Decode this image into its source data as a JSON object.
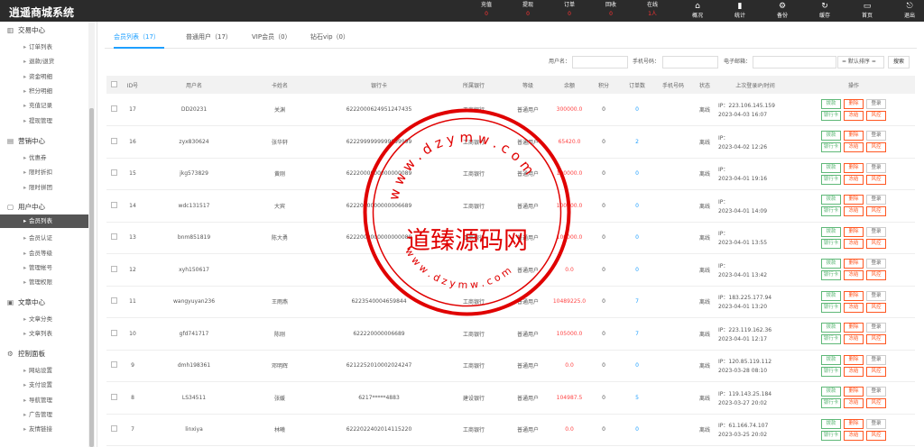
{
  "app": {
    "title": "逍遥商城系统"
  },
  "topstats": [
    {
      "label": "充值",
      "value": "0"
    },
    {
      "label": "提现",
      "value": "0"
    },
    {
      "label": "订单",
      "value": "0"
    },
    {
      "label": "回收",
      "value": "0"
    },
    {
      "label": "在线",
      "value": "1人"
    }
  ],
  "topnav": [
    {
      "label": "概况",
      "icon": "home-icon"
    },
    {
      "label": "统计",
      "icon": "bar-chart-icon"
    },
    {
      "label": "备份",
      "icon": "gear-icon"
    },
    {
      "label": "缓存",
      "icon": "refresh-icon"
    },
    {
      "label": "首页",
      "icon": "monitor-icon"
    },
    {
      "label": "退出",
      "icon": "logout-icon"
    }
  ],
  "sidebar": {
    "groups": [
      {
        "label": "交易中心",
        "icon": "chart-icon",
        "items": [
          "订单列表",
          "退款/退货",
          "资金明细",
          "积分明细",
          "充值记录",
          "提现管理"
        ]
      },
      {
        "label": "营销中心",
        "icon": "marketing-icon",
        "items": [
          "优惠券",
          "限时折扣",
          "限时拼团"
        ]
      },
      {
        "label": "用户中心",
        "icon": "user-icon",
        "items": [
          "会员列表",
          "会员认证",
          "会员等级",
          "管理帐号",
          "管理权限"
        ]
      },
      {
        "label": "文章中心",
        "icon": "article-icon",
        "items": [
          "文章分类",
          "文章列表"
        ]
      },
      {
        "label": "控制面板",
        "icon": "settings-icon",
        "items": [
          "网站设置",
          "支付设置",
          "导航管理",
          "广告管理",
          "友情链接"
        ]
      }
    ],
    "active": "会员列表"
  },
  "tabs": [
    {
      "label": "会员列表（17）"
    },
    {
      "label": "普通用户（17）"
    },
    {
      "label": "VIP会员（0）"
    },
    {
      "label": "钻石vip（0）"
    }
  ],
  "search": {
    "username_label": "用户名：",
    "phone_label": "手机号码：",
    "email_label": "电子邮箱：",
    "sort_value": "= 默认排序 =",
    "search_button": "搜索"
  },
  "table": {
    "headers": [
      "ID号",
      "用户名",
      "卡姓名",
      "银行卡",
      "所属银行",
      "等级",
      "余额",
      "积分",
      "订单数",
      "手机号码",
      "状态",
      "上次登录IP/时间",
      "操作"
    ],
    "rows": [
      {
        "id": "17",
        "username": "DD20231",
        "name": "关渊",
        "card": "6222000624951247435",
        "bank": "工商银行",
        "level": "普通用户",
        "balance": "300000.0",
        "points": "0",
        "orders": "0",
        "phone": "",
        "status": "离线",
        "ip": "IP：223.106.145.159",
        "time": "2023-04-03 16:07"
      },
      {
        "id": "16",
        "username": "zyx830624",
        "name": "张华轩",
        "card": "6222999999999999999",
        "bank": "工商银行",
        "level": "普通用户",
        "balance": "65420.0",
        "points": "0",
        "orders": "2",
        "phone": "",
        "status": "离线",
        "ip": "IP：",
        "time": "2023-04-02 12:26"
      },
      {
        "id": "15",
        "username": "jkg573829",
        "name": "黄刚",
        "card": "6222000000000000089",
        "bank": "工商银行",
        "level": "普通用户",
        "balance": "100000.0",
        "points": "0",
        "orders": "0",
        "phone": "",
        "status": "离线",
        "ip": "IP：",
        "time": "2023-04-01 19:16"
      },
      {
        "id": "14",
        "username": "wdc131517",
        "name": "大宾",
        "card": "6222000000000006689",
        "bank": "工商银行",
        "level": "普通用户",
        "balance": "100000.0",
        "points": "0",
        "orders": "0",
        "phone": "",
        "status": "离线",
        "ip": "IP：",
        "time": "2023-04-01 14:09"
      },
      {
        "id": "13",
        "username": "bnm851819",
        "name": "陈大勇",
        "card": "6222000000000000089",
        "bank": "工商银行",
        "level": "普通用户",
        "balance": "100000.0",
        "points": "0",
        "orders": "0",
        "phone": "",
        "status": "离线",
        "ip": "IP：",
        "time": "2023-04-01 13:55"
      },
      {
        "id": "12",
        "username": "xyh150617",
        "name": "",
        "card": "",
        "bank": "",
        "level": "普通用户",
        "balance": "0.0",
        "points": "0",
        "orders": "0",
        "phone": "",
        "status": "离线",
        "ip": "IP：",
        "time": "2023-04-01 13:42"
      },
      {
        "id": "11",
        "username": "wangyuyan236",
        "name": "王雨燕",
        "card": "6223540004659844",
        "bank": "工商银行",
        "level": "普通用户",
        "balance": "10489225.0",
        "points": "0",
        "orders": "7",
        "phone": "",
        "status": "离线",
        "ip": "IP：183.225.177.94",
        "time": "2023-04-01 13:20"
      },
      {
        "id": "10",
        "username": "gfd741717",
        "name": "陈刚",
        "card": "622220000006689",
        "bank": "工商银行",
        "level": "普通用户",
        "balance": "105000.0",
        "points": "0",
        "orders": "7",
        "phone": "",
        "status": "离线",
        "ip": "IP：223.119.162.36",
        "time": "2023-04-01 12:17"
      },
      {
        "id": "9",
        "username": "dmh198361",
        "name": "邓明辉",
        "card": "6212252010002024247",
        "bank": "工商银行",
        "level": "普通用户",
        "balance": "0.0",
        "points": "0",
        "orders": "0",
        "phone": "",
        "status": "离线",
        "ip": "IP：120.85.119.112",
        "time": "2023-03-28 08:10"
      },
      {
        "id": "8",
        "username": "LS34511",
        "name": "张媛",
        "card": "6217*****4883",
        "bank": "建设银行",
        "level": "普通用户",
        "balance": "104987.5",
        "points": "0",
        "orders": "5",
        "phone": "",
        "status": "离线",
        "ip": "IP：119.143.25.184",
        "time": "2023-03-27 20:02"
      },
      {
        "id": "7",
        "username": "linxiya",
        "name": "林曦",
        "card": "6222022402014115220",
        "bank": "工商银行",
        "level": "普通用户",
        "balance": "0.0",
        "points": "0",
        "orders": "0",
        "phone": "",
        "status": "离线",
        "ip": "IP：61.166.74.107",
        "time": "2023-03-25 20:02"
      }
    ],
    "ops": [
      "拨款",
      "删除",
      "登录",
      "银行卡",
      "冻结",
      "风控"
    ]
  },
  "watermark": {
    "center": "道臻源码网",
    "url_top": "w w w . d z y m w . c o m",
    "url_bottom": "w w w . d z y m w . c o m",
    "color": "#e00000"
  }
}
